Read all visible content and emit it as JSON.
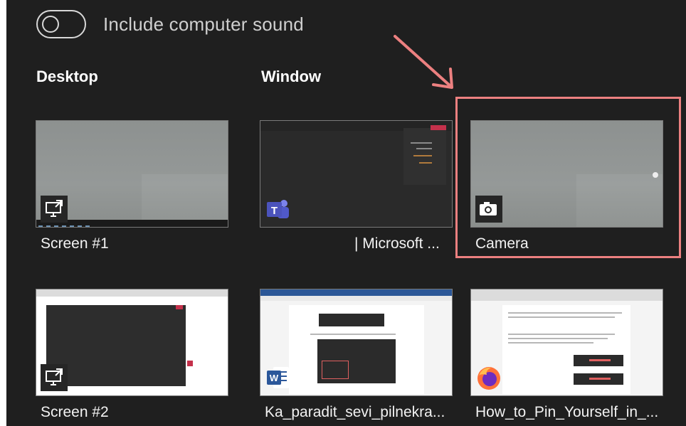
{
  "toggle": {
    "label": "Include computer sound",
    "on": false
  },
  "sections": {
    "desktop": "Desktop",
    "window": "Window"
  },
  "tiles": [
    {
      "label": "Screen #1",
      "icon": "share-screen-icon"
    },
    {
      "label": "| Microsoft ...",
      "icon": "teams-icon"
    },
    {
      "label": "Camera",
      "icon": "camera-icon"
    },
    {
      "label": "Screen #2",
      "icon": "share-screen-icon"
    },
    {
      "label": "Ka_paradit_sevi_pilnekra...",
      "icon": "word-icon"
    },
    {
      "label": "How_to_Pin_Yourself_in_...",
      "icon": "firefox-icon"
    }
  ],
  "annotation": {
    "arrow_color": "#ec8080",
    "highlight_color": "#ec8080"
  }
}
